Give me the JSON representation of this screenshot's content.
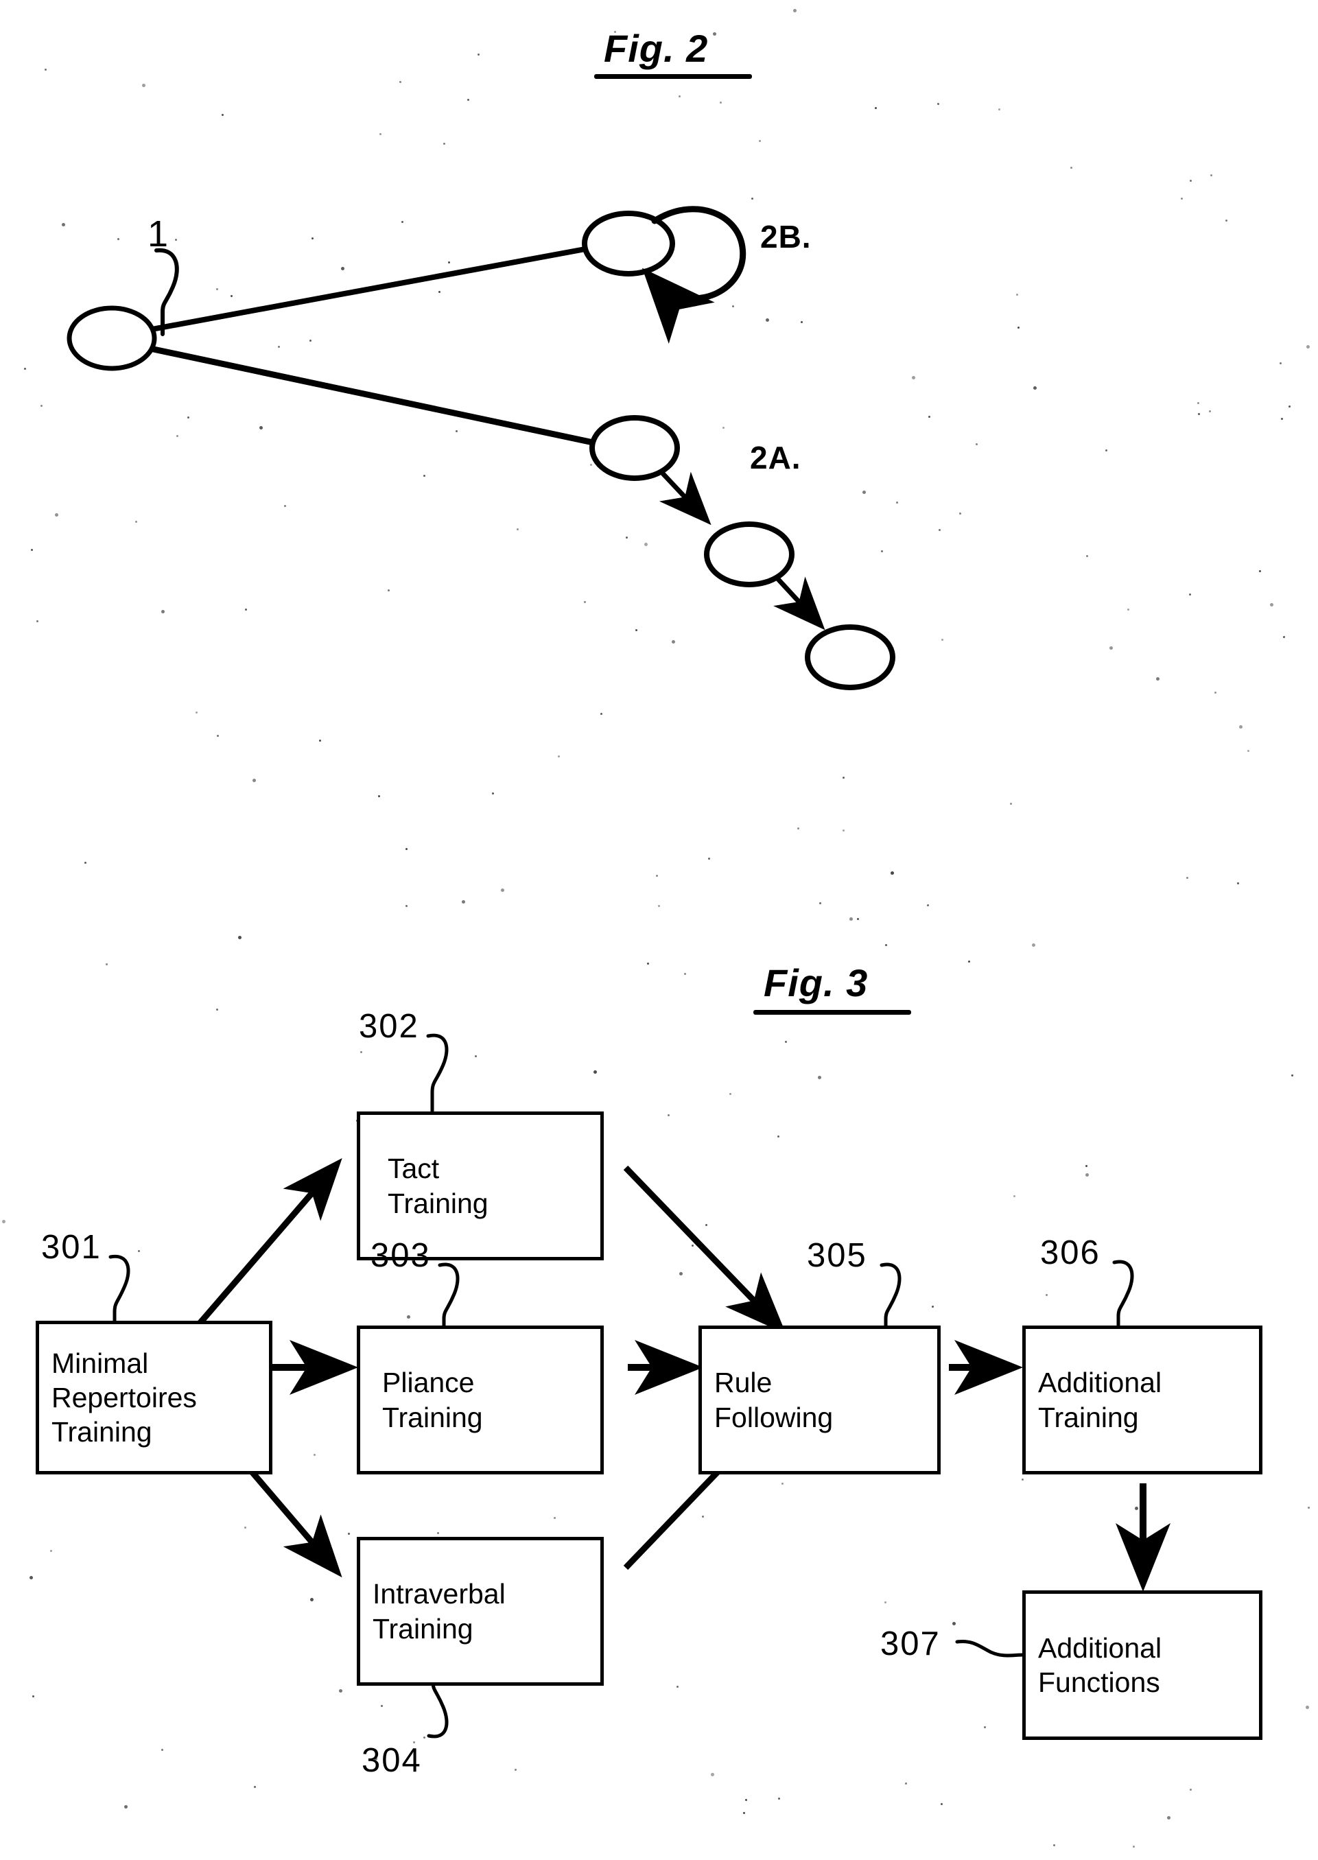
{
  "document": {
    "type": "patent-drawing-sheet",
    "background_color": "#ffffff",
    "ink_color": "#000000"
  },
  "figures": [
    {
      "id": "fig2",
      "title": "Fig. 2",
      "kind": "node-graph",
      "nodes": [
        {
          "id": "root",
          "shape": "ellipse",
          "label": ""
        },
        {
          "id": "b1",
          "shape": "ellipse",
          "label": ""
        },
        {
          "id": "a1",
          "shape": "ellipse",
          "label": ""
        },
        {
          "id": "a2",
          "shape": "ellipse",
          "label": ""
        },
        {
          "id": "a3",
          "shape": "ellipse",
          "label": ""
        }
      ],
      "callouts": [
        {
          "text": "1",
          "target": "root",
          "position": "above-left"
        },
        {
          "text": "2B.",
          "target": "b1",
          "position": "right"
        },
        {
          "text": "2A.",
          "target": "a1",
          "position": "right"
        }
      ],
      "edges": [
        {
          "from": "root",
          "to": "b1",
          "arrow": false
        },
        {
          "from": "root",
          "to": "a1",
          "arrow": false
        },
        {
          "from": "b1",
          "to": "b1",
          "arrow": true,
          "kind": "self-loop"
        },
        {
          "from": "a1",
          "to": "a2",
          "arrow": true
        },
        {
          "from": "a2",
          "to": "a3",
          "arrow": true
        }
      ]
    },
    {
      "id": "fig3",
      "title": "Fig. 3",
      "kind": "flowchart",
      "boxes": [
        {
          "ref": "301",
          "label": "Minimal\nRepertoires\nTraining",
          "ref_position": "above-left"
        },
        {
          "ref": "302",
          "label": "Tact\nTraining",
          "ref_position": "above-left"
        },
        {
          "ref": "303",
          "label": "Pliance\nTraining",
          "ref_position": "above-left"
        },
        {
          "ref": "304",
          "label": "Intraverbal\nTraining",
          "ref_position": "below-left"
        },
        {
          "ref": "305",
          "label": "Rule\nFollowing",
          "ref_position": "above-right"
        },
        {
          "ref": "306",
          "label": "Additional\nTraining",
          "ref_position": "above-left"
        },
        {
          "ref": "307",
          "label": "Additional\nFunctions",
          "ref_position": "left"
        }
      ],
      "connections": [
        {
          "from": "301",
          "to": "302",
          "style": "diagonal-up",
          "arrow": true
        },
        {
          "from": "301",
          "to": "303",
          "style": "horizontal",
          "arrow": true
        },
        {
          "from": "301",
          "to": "304",
          "style": "diagonal-down",
          "arrow": true
        },
        {
          "from": "302",
          "to": "305",
          "style": "diagonal-down",
          "arrow": true
        },
        {
          "from": "303",
          "to": "305",
          "style": "horizontal",
          "arrow": true
        },
        {
          "from": "304",
          "to": "305",
          "style": "diagonal-up",
          "arrow": true
        },
        {
          "from": "305",
          "to": "306",
          "style": "horizontal",
          "arrow": true
        },
        {
          "from": "306",
          "to": "307",
          "style": "vertical-down",
          "arrow": true
        }
      ]
    }
  ],
  "fig2": {
    "title": "Fig. 2",
    "label_1": "1",
    "label_2b": "2B.",
    "label_2a": "2A."
  },
  "fig3": {
    "title": "Fig. 3",
    "ref_301": "301",
    "ref_302": "302",
    "ref_303": "303",
    "ref_304": "304",
    "ref_305": "305",
    "ref_306": "306",
    "ref_307": "307",
    "box_301": "Minimal\nRepertoires\nTraining",
    "box_302": "Tact\nTraining",
    "box_303": "Pliance\nTraining",
    "box_304": "Intraverbal\nTraining",
    "box_305": "Rule\nFollowing",
    "box_306": "Additional\nTraining",
    "box_307": "Additional\nFunctions"
  }
}
